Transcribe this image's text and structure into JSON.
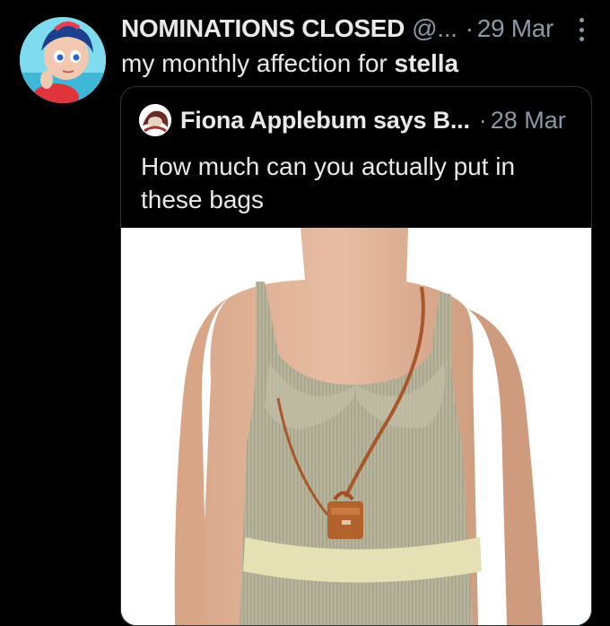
{
  "tweet": {
    "display_name": "NOMINATIONS CLOSED",
    "handle": "@...",
    "separator": "·",
    "time": "29 Mar",
    "text_prefix": "my monthly affection for ",
    "text_bold": "stella"
  },
  "quoted": {
    "display_name": "Fiona Applebum says B...",
    "separator": "·",
    "time": "28 Mar",
    "text": "How much can you actually put in these bags"
  },
  "icons": {
    "more": "more-options-icon",
    "avatar": "avatar",
    "quoted_avatar": "quoted-avatar"
  },
  "colors": {
    "background": "#000000",
    "text": "#e7e9ea",
    "muted": "#8b98a5",
    "border": "#2f3336"
  }
}
